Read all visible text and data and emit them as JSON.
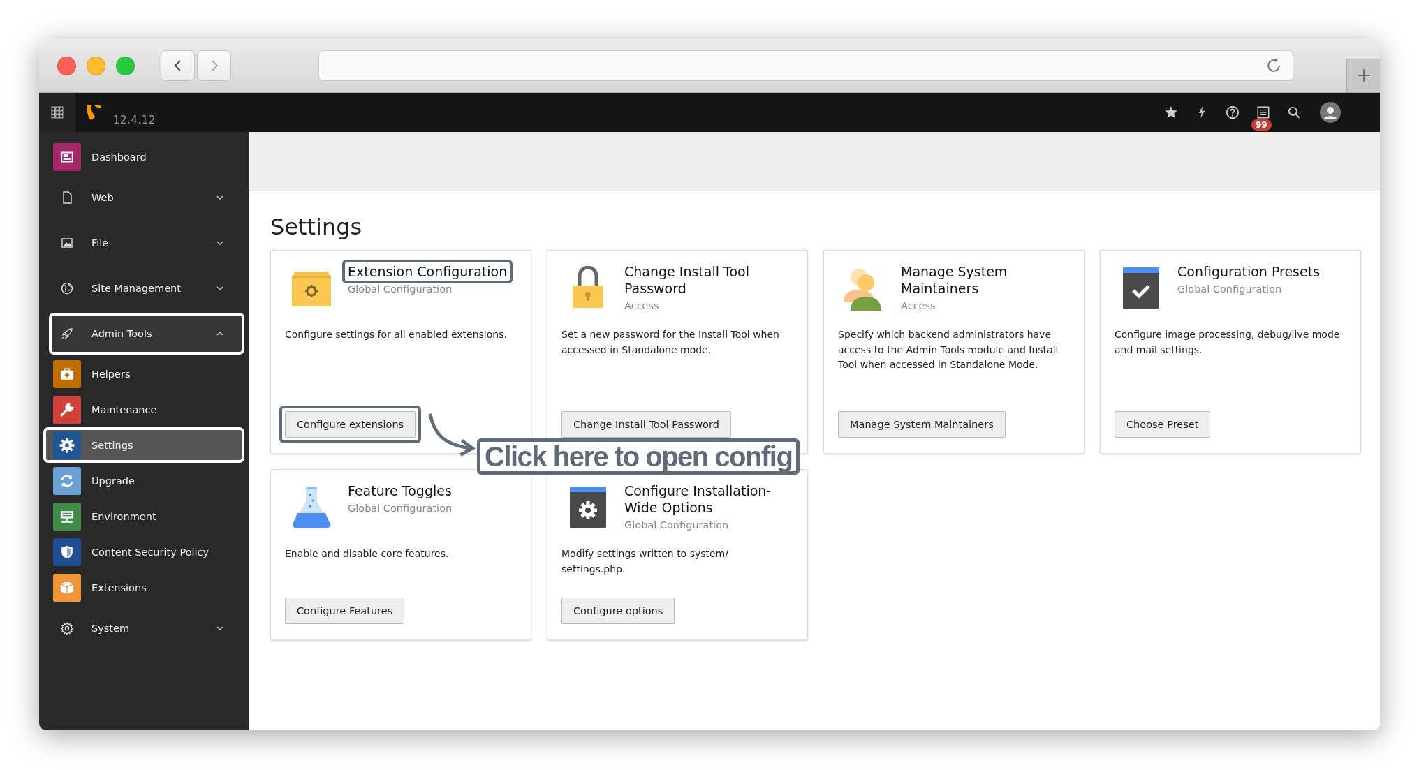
{
  "browser": {
    "back_enabled": true,
    "forward_enabled": false
  },
  "topbar": {
    "version": "12.4.12",
    "notification_count": "99"
  },
  "sidebar": {
    "items": [
      {
        "label": "Dashboard",
        "kind": "module",
        "color": "#a4276a",
        "selected": false,
        "highlighted": false
      },
      {
        "label": "Web",
        "kind": "group",
        "expanded": false,
        "highlighted": false
      },
      {
        "label": "File",
        "kind": "group",
        "expanded": false,
        "highlighted": false
      },
      {
        "label": "Site Management",
        "kind": "group",
        "expanded": false,
        "highlighted": false
      },
      {
        "label": "Admin Tools",
        "kind": "group",
        "expanded": true,
        "highlighted": true,
        "children": [
          {
            "label": "Helpers",
            "kind": "module",
            "color": "#c16d00",
            "selected": false,
            "highlighted": false
          },
          {
            "label": "Maintenance",
            "kind": "module",
            "color": "#d1403a",
            "selected": false,
            "highlighted": false
          },
          {
            "label": "Settings",
            "kind": "module",
            "color": "#1f5694",
            "selected": true,
            "highlighted": true
          },
          {
            "label": "Upgrade",
            "kind": "module",
            "color": "#6c9fd3",
            "selected": false,
            "highlighted": false
          },
          {
            "label": "Environment",
            "kind": "module",
            "color": "#3f8c4a",
            "selected": false,
            "highlighted": false
          },
          {
            "label": "Content Security Policy",
            "kind": "module",
            "color": "#1f4d94",
            "selected": false,
            "highlighted": false
          },
          {
            "label": "Extensions",
            "kind": "module",
            "color": "#f3963a",
            "selected": false,
            "highlighted": false
          }
        ]
      },
      {
        "label": "System",
        "kind": "group",
        "expanded": false,
        "highlighted": false
      }
    ]
  },
  "page": {
    "title": "Settings"
  },
  "cards": [
    {
      "title": "Extension Configuration",
      "subtitle": "Global Configuration",
      "description": "Configure settings for all enabled extensions.",
      "button": "Configure extensions",
      "title_highlighted": true,
      "button_highlighted": true
    },
    {
      "title": "Change Install Tool Password",
      "subtitle": "Access",
      "description": "Set a new password for the Install Tool when accessed in Standalone mode.",
      "button": "Change Install Tool Password",
      "title_highlighted": false,
      "button_highlighted": false
    },
    {
      "title": "Manage System Maintainers",
      "subtitle": "Access",
      "description": "Specify which backend administrators have access to the Admin Tools module and Install Tool when accessed in Standalone Mode.",
      "button": "Manage System Maintainers",
      "title_highlighted": false,
      "button_highlighted": false
    },
    {
      "title": "Configuration Presets",
      "subtitle": "Global Configuration",
      "description": "Configure image processing, debug/live mode and mail settings.",
      "button": "Choose Preset",
      "title_highlighted": false,
      "button_highlighted": false
    },
    {
      "title": "Feature Toggles",
      "subtitle": "Global Configuration",
      "description": "Enable and disable core features.",
      "button": "Configure Features",
      "title_highlighted": false,
      "button_highlighted": false
    },
    {
      "title": "Configure Installation-Wide Options",
      "subtitle": "Global Configuration",
      "description": "Modify settings written to system/ settings.php.",
      "button": "Configure options",
      "title_highlighted": false,
      "button_highlighted": false
    }
  ],
  "callout": {
    "text": "Click here to open config"
  }
}
